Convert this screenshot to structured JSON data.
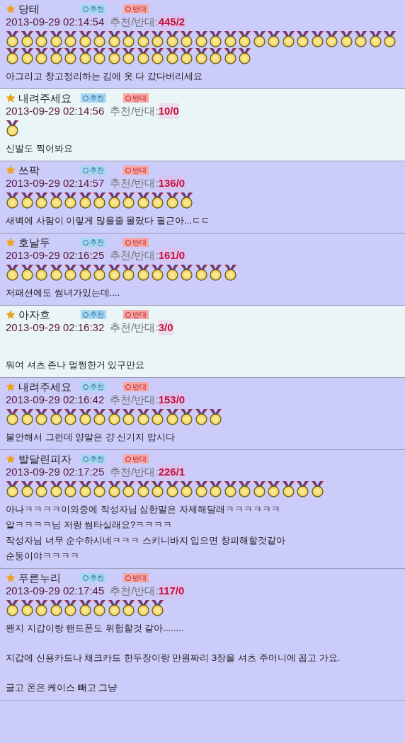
{
  "comments": [
    {
      "author": "당테",
      "up": "추천",
      "down": "반대",
      "date": "2013-09-29 02:14:54",
      "votes_label": "추천/반대:",
      "votes": "445/2",
      "color": "#ccccfa",
      "medals": [
        {
          "kind": "medal"
        },
        {
          "kind": "medal"
        },
        {
          "kind": "medal"
        },
        {
          "kind": "medal"
        },
        {
          "kind": "medal"
        },
        {
          "kind": "medal"
        },
        {
          "kind": "medal"
        },
        {
          "kind": "medal"
        },
        {
          "kind": "medal"
        },
        {
          "kind": "medal"
        },
        {
          "kind": "medal"
        },
        {
          "kind": "medal"
        },
        {
          "kind": "medal"
        },
        {
          "kind": "medal"
        },
        {
          "kind": "medal"
        },
        {
          "kind": "medal"
        },
        {
          "kind": "medal"
        },
        {
          "kind": "medal"
        },
        {
          "kind": "medal"
        },
        {
          "kind": "medal"
        },
        {
          "kind": "medal"
        },
        {
          "kind": "medal"
        },
        {
          "kind": "medal"
        },
        {
          "kind": "medal"
        },
        {
          "kind": "medal"
        },
        {
          "kind": "medal"
        },
        {
          "kind": "medal"
        },
        {
          "kind": "medal"
        },
        {
          "kind": "medal"
        },
        {
          "kind": "medal"
        },
        {
          "kind": "medal"
        },
        {
          "kind": "medal"
        },
        {
          "kind": "medal"
        },
        {
          "kind": "medal"
        },
        {
          "kind": "medal"
        },
        {
          "kind": "medal"
        },
        {
          "kind": "medal"
        },
        {
          "kind": "medal"
        },
        {
          "kind": "medal"
        },
        {
          "kind": "medal"
        },
        {
          "kind": "medal"
        },
        {
          "kind": "medal"
        },
        {
          "kind": "medal"
        },
        {
          "kind": "medal"
        }
      ],
      "paragraphs": [
        [
          "아그리고 창고정리하는 김에 옷 다 갔다버리세요"
        ]
      ]
    },
    {
      "author": "내려주세요",
      "up": "추천",
      "down": "반대",
      "date": "2013-09-29 02:14:56",
      "votes_label": "추천/반대:",
      "votes": "10/0",
      "color": "#eaf5f8",
      "medals": [
        {
          "kind": "medal"
        }
      ],
      "paragraphs": [
        [
          "신발도 찍어봐요"
        ]
      ]
    },
    {
      "author": "쓰팍",
      "up": "추천",
      "down": "반대",
      "date": "2013-09-29 02:14:57",
      "votes_label": "추천/반대:",
      "votes": "136/0",
      "color": "#ccccfa",
      "medals": [
        {
          "kind": "medal"
        },
        {
          "kind": "medal"
        },
        {
          "kind": "medal"
        },
        {
          "kind": "medal"
        },
        {
          "kind": "medal"
        },
        {
          "kind": "medal"
        },
        {
          "kind": "medal"
        },
        {
          "kind": "medal"
        },
        {
          "kind": "medal"
        },
        {
          "kind": "medal"
        },
        {
          "kind": "medal"
        },
        {
          "kind": "medal"
        },
        {
          "kind": "medal"
        }
      ],
      "paragraphs": [
        [
          "새벽에 사람이 이렇게 많을줄 몰랐다 필근아...ㄷㄷ"
        ]
      ]
    },
    {
      "author": "호날두",
      "up": "추천",
      "down": "반대",
      "date": "2013-09-29 02:16:25",
      "votes_label": "추천/반대:",
      "votes": "161/0",
      "color": "#ccccfa",
      "medals": [
        {
          "kind": "medal"
        },
        {
          "kind": "medal"
        },
        {
          "kind": "medal"
        },
        {
          "kind": "medal"
        },
        {
          "kind": "medal"
        },
        {
          "kind": "medal"
        },
        {
          "kind": "medal"
        },
        {
          "kind": "medal"
        },
        {
          "kind": "medal"
        },
        {
          "kind": "medal"
        },
        {
          "kind": "medal"
        },
        {
          "kind": "medal"
        },
        {
          "kind": "medal"
        },
        {
          "kind": "medal"
        },
        {
          "kind": "medal"
        },
        {
          "kind": "medal"
        }
      ],
      "paragraphs": [
        [
          "저패션에도 썸녀가있는데...."
        ]
      ]
    },
    {
      "author": "아자흐",
      "up": "추천",
      "down": "반대",
      "date": "2013-09-29 02:16:32",
      "votes_label": "추천/반대:",
      "votes": "3/0",
      "color": "#eaf5f8",
      "paragraphs": [
        [
          "뭐여 셔츠 존나 멀쩡한거 있구만요"
        ]
      ]
    },
    {
      "author": "내려주세요",
      "up": "추천",
      "down": "반대",
      "date": "2013-09-29 02:16:42",
      "votes_label": "추천/반대:",
      "votes": "153/0",
      "color": "#ccccfa",
      "medals": [
        {
          "kind": "medal"
        },
        {
          "kind": "medal"
        },
        {
          "kind": "medal"
        },
        {
          "kind": "medal"
        },
        {
          "kind": "medal"
        },
        {
          "kind": "medal"
        },
        {
          "kind": "medal"
        },
        {
          "kind": "medal"
        },
        {
          "kind": "medal"
        },
        {
          "kind": "medal"
        },
        {
          "kind": "medal"
        },
        {
          "kind": "medal"
        },
        {
          "kind": "medal"
        },
        {
          "kind": "medal"
        },
        {
          "kind": "medal"
        }
      ],
      "paragraphs": [
        [
          "불안해서 그런데 양말은 걍 신기지 맙시다"
        ]
      ]
    },
    {
      "author": "발달린피자",
      "up": "추천",
      "down": "반대",
      "date": "2013-09-29 02:17:25",
      "votes_label": "추천/반대:",
      "votes": "226/1",
      "color": "#ccccfa",
      "medals": [
        {
          "kind": "medal"
        },
        {
          "kind": "medal"
        },
        {
          "kind": "medal"
        },
        {
          "kind": "medal"
        },
        {
          "kind": "medal"
        },
        {
          "kind": "medal"
        },
        {
          "kind": "medal"
        },
        {
          "kind": "medal"
        },
        {
          "kind": "medal"
        },
        {
          "kind": "medal"
        },
        {
          "kind": "medal"
        },
        {
          "kind": "medal"
        },
        {
          "kind": "medal"
        },
        {
          "kind": "medal"
        },
        {
          "kind": "medal"
        },
        {
          "kind": "medal"
        },
        {
          "kind": "medal"
        },
        {
          "kind": "medal"
        },
        {
          "kind": "medal"
        },
        {
          "kind": "medal"
        },
        {
          "kind": "medal"
        },
        {
          "kind": "medal"
        }
      ],
      "paragraphs": [
        [
          "아나ㅋㅋㅋㅋ이와중에 작성자님 심한말은 자제해달래ㅋㅋㅋㅋㅋㅋ",
          "알ㅋㅋㅋㅋ님 저랑 썸타실래요?ㅋㅋㅋㅋ",
          "작성자님 너무 순수하시네ㅋㅋㅋ 스키니바지 입으면 창피해할것같아",
          "순둥이야ㅋㅋㅋㅋ"
        ]
      ]
    },
    {
      "author": "푸른누리",
      "up": "추천",
      "down": "반대",
      "date": "2013-09-29 02:17:45",
      "votes_label": "추천/반대:",
      "votes": "117/0",
      "color": "#ccccfa",
      "medals": [
        {
          "kind": "medal"
        },
        {
          "kind": "medal"
        },
        {
          "kind": "medal"
        },
        {
          "kind": "medal"
        },
        {
          "kind": "medal"
        },
        {
          "kind": "medal"
        },
        {
          "kind": "medal"
        },
        {
          "kind": "medal"
        },
        {
          "kind": "medal"
        },
        {
          "kind": "medal"
        },
        {
          "kind": "medal"
        }
      ],
      "paragraphs": [
        [
          "왠지 지갑이랑 핸드폰도 위험할것 같아........"
        ],
        [
          "지갑에 신용카드나 채크카드 한두장이랑 만원짜리 3장을 셔츠 주머니에 꼽고 가요."
        ],
        [
          "글고 폰은 케이스 빼고 그냥"
        ]
      ]
    }
  ]
}
